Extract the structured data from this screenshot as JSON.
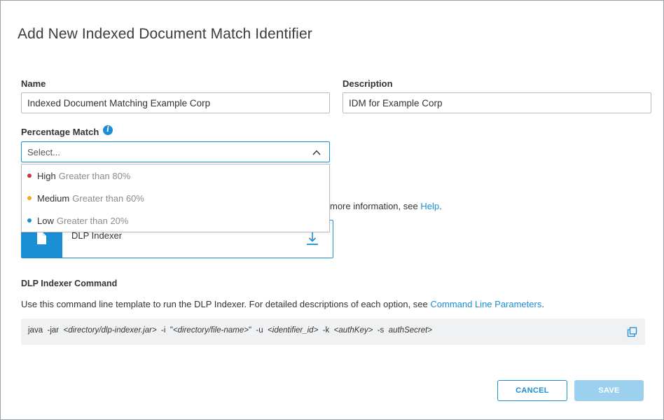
{
  "dialog": {
    "title": "Add New Indexed Document Match Identifier"
  },
  "form": {
    "name_label": "Name",
    "name_value": "Indexed Document Matching Example Corp",
    "description_label": "Description",
    "description_value": "IDM for Example Corp",
    "percentage_label": "Percentage Match",
    "percentage_placeholder": "Select..."
  },
  "percentage_options": [
    {
      "level": "High",
      "desc": "Greater than 80%",
      "color": "#d0343a"
    },
    {
      "level": "Medium",
      "desc": "Greater than 60%",
      "color": "#f5a623"
    },
    {
      "level": "Low",
      "desc": "Greater than 20%",
      "color": "#1a8fd6"
    }
  ],
  "help": {
    "text": "more information, see ",
    "link": "Help",
    "suffix": "."
  },
  "indexer": {
    "label": "DLP Indexer"
  },
  "command": {
    "section_title": "DLP Indexer Command",
    "description": "Use this command line template to run the DLP Indexer. For detailed descriptions of each option, see ",
    "description_link": "Command Line Parameters",
    "description_suffix": ".",
    "parts": {
      "p1": "java  -jar  ",
      "a1": "<directory/dlp-indexer.jar>",
      "p2": "  -i  \"",
      "a2": "<directory/file-name>",
      "p3": "\"  -u  ",
      "a3": "<identifier_id>",
      "p4": "  -k  ",
      "a4": "<authKey>",
      "p5": "  -s  ",
      "a5": "authSecret>"
    }
  },
  "buttons": {
    "cancel": "CANCEL",
    "save": "SAVE"
  },
  "colors": {
    "accent": "#1a8fd6",
    "save_disabled": "#9bd0ee"
  }
}
